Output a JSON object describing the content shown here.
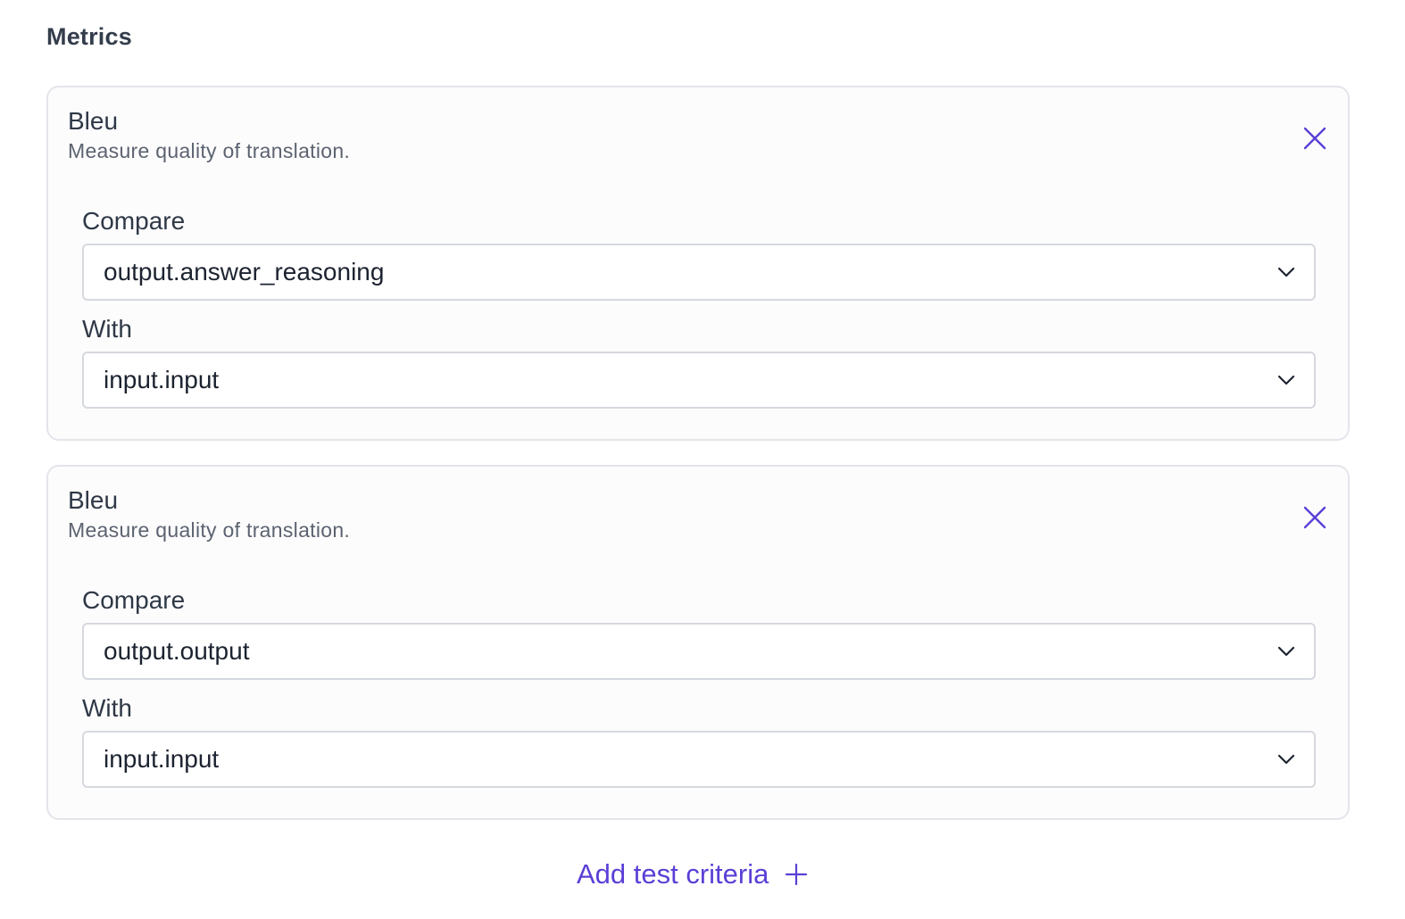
{
  "section": {
    "title": "Metrics"
  },
  "metrics": [
    {
      "name": "Bleu",
      "description": "Measure quality of translation.",
      "compare_label": "Compare",
      "compare_value": "output.answer_reasoning",
      "with_label": "With",
      "with_value": "input.input"
    },
    {
      "name": "Bleu",
      "description": "Measure quality of translation.",
      "compare_label": "Compare",
      "compare_value": "output.output",
      "with_label": "With",
      "with_value": "input.input"
    }
  ],
  "add_button": {
    "label": "Add test criteria"
  },
  "icons": {
    "remove": "close-icon",
    "dropdown": "chevron-down-icon",
    "add": "plus-icon"
  },
  "colors": {
    "accent": "#5b3fd6",
    "card_border": "#e3e5ea",
    "select_border": "#d5d8de"
  }
}
